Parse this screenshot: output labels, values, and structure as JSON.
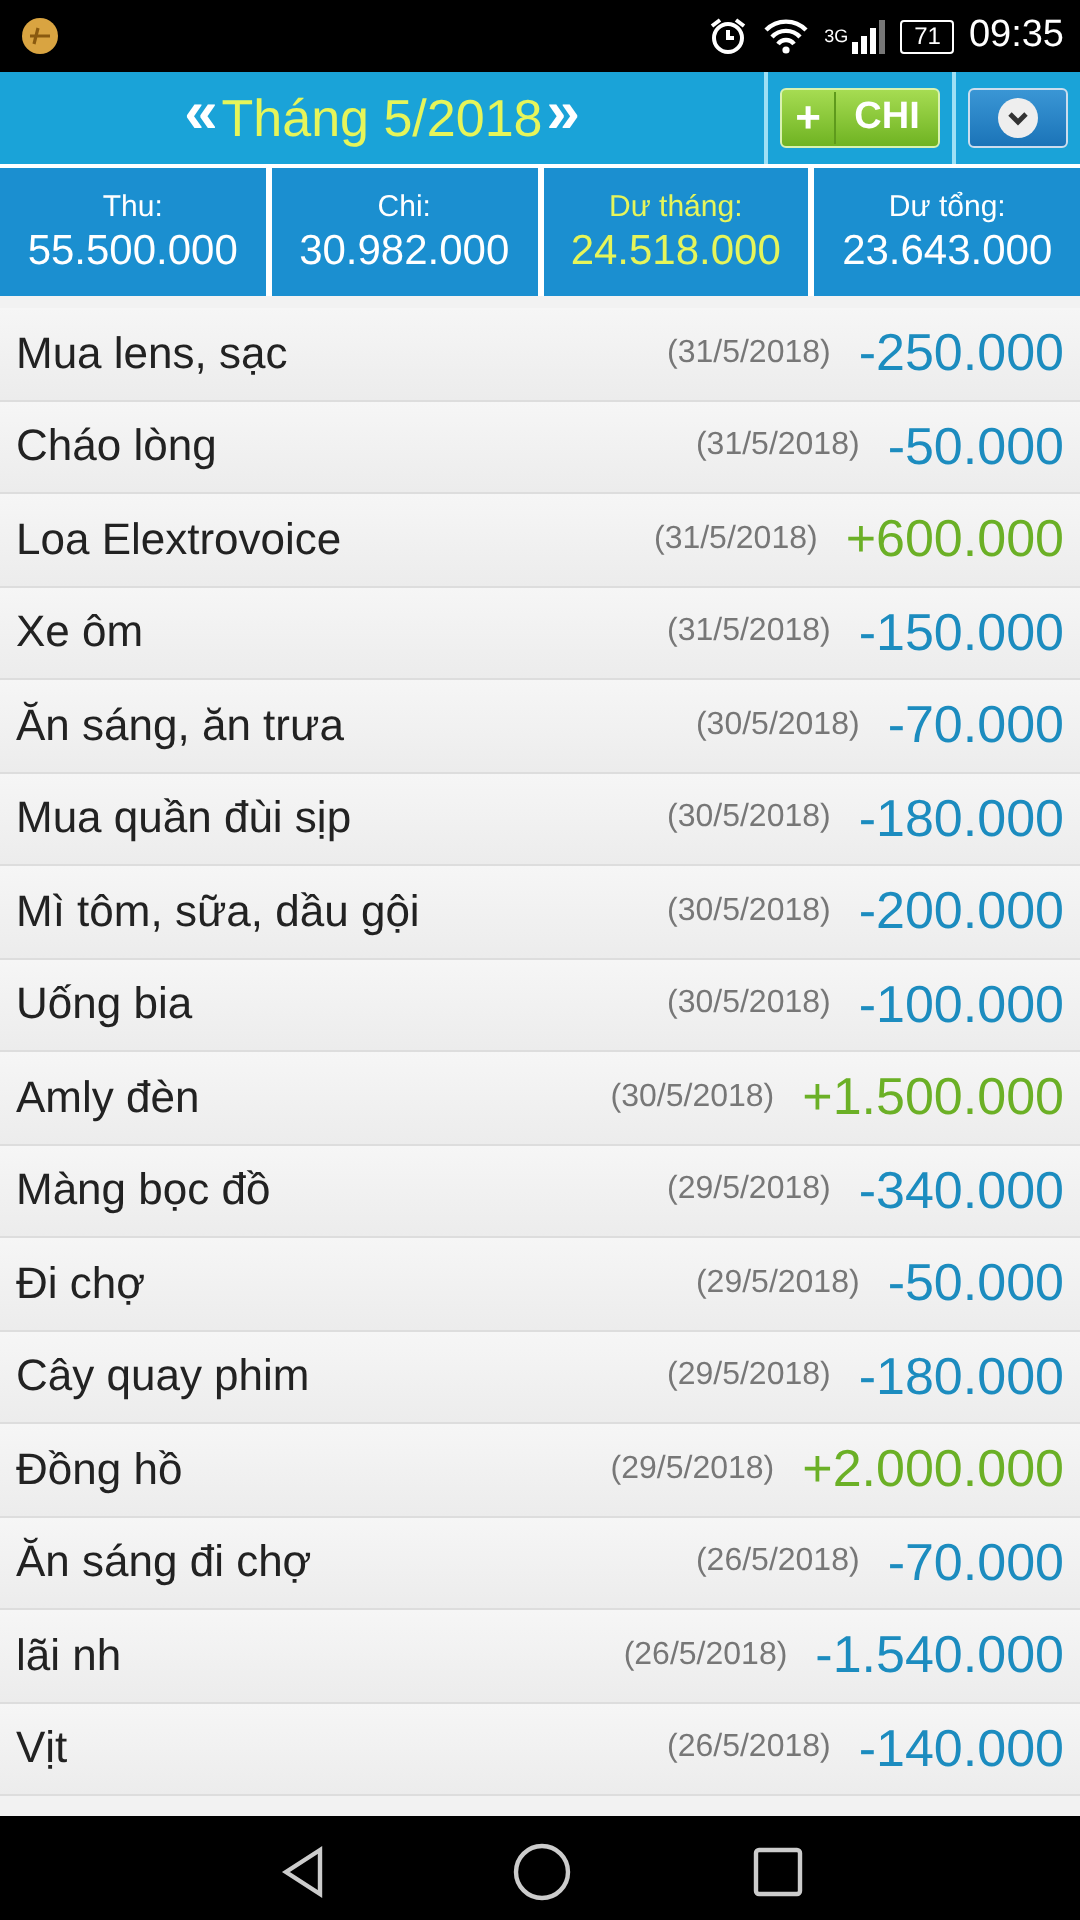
{
  "status_bar": {
    "network": "3G",
    "battery": "71",
    "time": "09:35"
  },
  "header": {
    "prev": "«",
    "title": "Tháng 5/2018",
    "next": "»",
    "add_button": {
      "plus": "+",
      "label": "CHI"
    }
  },
  "summary": [
    {
      "label": "Thu:",
      "value": "55.500.000",
      "highlight": false
    },
    {
      "label": "Chi:",
      "value": "30.982.000",
      "highlight": false
    },
    {
      "label": "Dư tháng:",
      "value": "24.518.000",
      "highlight": true
    },
    {
      "label": "Dư tổng:",
      "value": "23.643.000",
      "highlight": false
    }
  ],
  "transactions": [
    {
      "name": "Mua lens, sạc",
      "date": "(31/5/2018)",
      "amount": "-250.000",
      "kind": "expense"
    },
    {
      "name": "Cháo lòng",
      "date": "(31/5/2018)",
      "amount": "-50.000",
      "kind": "expense"
    },
    {
      "name": "Loa Elextrovoice",
      "date": "(31/5/2018)",
      "amount": "+600.000",
      "kind": "income"
    },
    {
      "name": "Xe ôm",
      "date": "(31/5/2018)",
      "amount": "-150.000",
      "kind": "expense"
    },
    {
      "name": "Ăn sáng, ăn trưa",
      "date": "(30/5/2018)",
      "amount": "-70.000",
      "kind": "expense"
    },
    {
      "name": "Mua quần đùi sịp",
      "date": "(30/5/2018)",
      "amount": "-180.000",
      "kind": "expense"
    },
    {
      "name": "Mì tôm, sữa, dầu gội",
      "date": "(30/5/2018)",
      "amount": "-200.000",
      "kind": "expense"
    },
    {
      "name": "Uống bia",
      "date": "(30/5/2018)",
      "amount": "-100.000",
      "kind": "expense"
    },
    {
      "name": "Amly đèn",
      "date": "(30/5/2018)",
      "amount": "+1.500.000",
      "kind": "income"
    },
    {
      "name": "Màng bọc đồ",
      "date": "(29/5/2018)",
      "amount": "-340.000",
      "kind": "expense"
    },
    {
      "name": "Đi chợ",
      "date": "(29/5/2018)",
      "amount": "-50.000",
      "kind": "expense"
    },
    {
      "name": "Cây quay phim",
      "date": "(29/5/2018)",
      "amount": "-180.000",
      "kind": "expense"
    },
    {
      "name": "Đồng hồ",
      "date": "(29/5/2018)",
      "amount": "+2.000.000",
      "kind": "income"
    },
    {
      "name": "Ăn sáng đi chợ",
      "date": "(26/5/2018)",
      "amount": "-70.000",
      "kind": "expense"
    },
    {
      "name": "lãi nh",
      "date": "(26/5/2018)",
      "amount": "-1.540.000",
      "kind": "expense"
    },
    {
      "name": "Vịt",
      "date": "(26/5/2018)",
      "amount": "-140.000",
      "kind": "expense"
    }
  ]
}
